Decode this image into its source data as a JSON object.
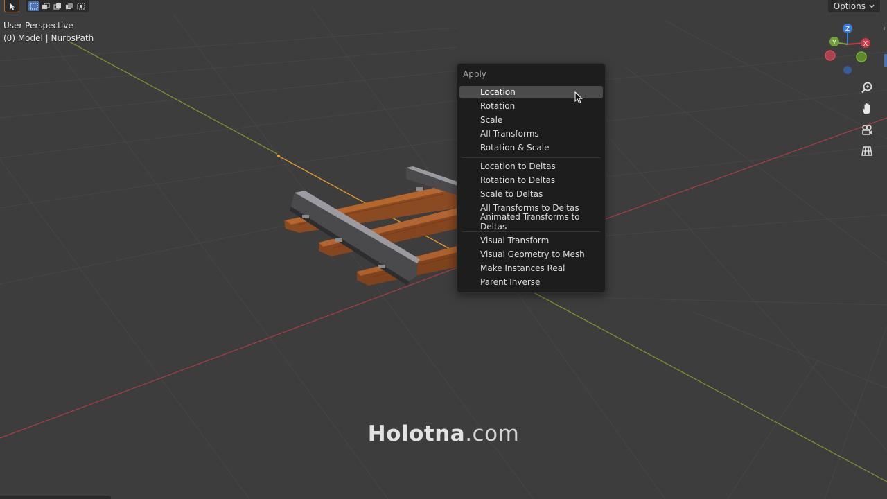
{
  "viewport": {
    "view_name": "User Perspective",
    "object_info": "(0) Model | NurbsPath",
    "options_label": "Options",
    "colors": {
      "background": "#3d3d3d",
      "grid": "#474747",
      "x_axis": "#a83c44",
      "y_axis": "#7f9a2c",
      "path_selected": "#e39a2a",
      "highlight": "#4b4b4b",
      "menu_bg": "#1d1d1d"
    }
  },
  "toolbar": {
    "select_tool_icon": "select-cursor-icon",
    "modes": [
      "select-new-icon",
      "select-extend-icon",
      "select-subtract-icon",
      "select-invert-icon",
      "select-intersect-icon"
    ]
  },
  "gizmo": {
    "z": "Z",
    "y": "Y",
    "x": "X"
  },
  "nav_tools": [
    "zoom-icon",
    "hand-pan-icon",
    "camera-icon",
    "grid-ortho-icon"
  ],
  "menu": {
    "title": "Apply",
    "groups": [
      [
        "Location",
        "Rotation",
        "Scale",
        "All Transforms",
        "Rotation & Scale"
      ],
      [
        "Location to Deltas",
        "Rotation to Deltas",
        "Scale to Deltas",
        "All Transforms to Deltas",
        "Animated Transforms to Deltas"
      ],
      [
        "Visual Transform",
        "Visual Geometry to Mesh",
        "Make Instances Real",
        "Parent Inverse"
      ]
    ],
    "highlighted": "Location"
  },
  "watermark": {
    "brand": "Holotna",
    "suffix": ".com"
  }
}
